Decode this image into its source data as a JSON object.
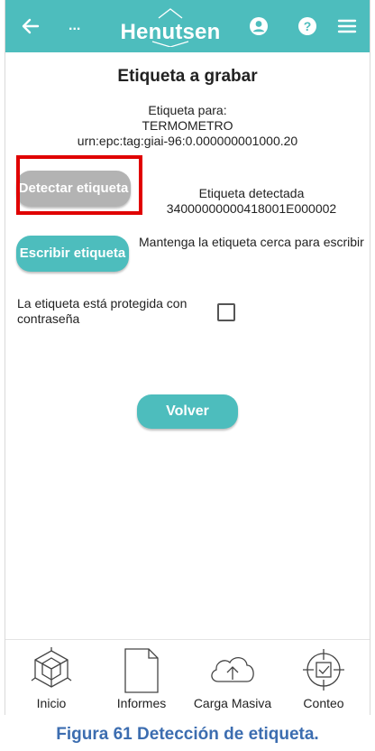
{
  "header": {
    "back_icon": "arrow-left-icon",
    "more_label": "...",
    "logo_text": "Henutsen",
    "user_icon": "user-circle-icon",
    "help_icon": "question-circle-icon",
    "menu_icon": "hamburger-menu-icon",
    "bar_color": "#4dbdbd"
  },
  "main": {
    "title": "Etiqueta a grabar",
    "tag_for_label": "Etiqueta para:",
    "tag_name": "TERMOMETRO",
    "tag_urn": "urn:epc:tag:giai-96:0.000000001000.20",
    "detect_button": "Detectar etiqueta",
    "detected_label": "Etiqueta detectada",
    "detected_value": "34000000000418001E000002",
    "write_button": "Escribir etiqueta",
    "write_hint": "Mantenga la etiqueta cerca para escribir",
    "password_label": "La etiqueta está protegida con contraseña",
    "password_checked": false,
    "back_button": "Volver",
    "highlight_color": "#e00000"
  },
  "footer": {
    "items": [
      {
        "label": "Inicio",
        "icon": "cube-home-icon"
      },
      {
        "label": "Informes",
        "icon": "document-icon"
      },
      {
        "label": "Carga Masiva",
        "icon": "cloud-upload-icon"
      },
      {
        "label": "Conteo",
        "icon": "target-check-icon"
      }
    ]
  },
  "caption": "Figura 61 Detección de etiqueta."
}
